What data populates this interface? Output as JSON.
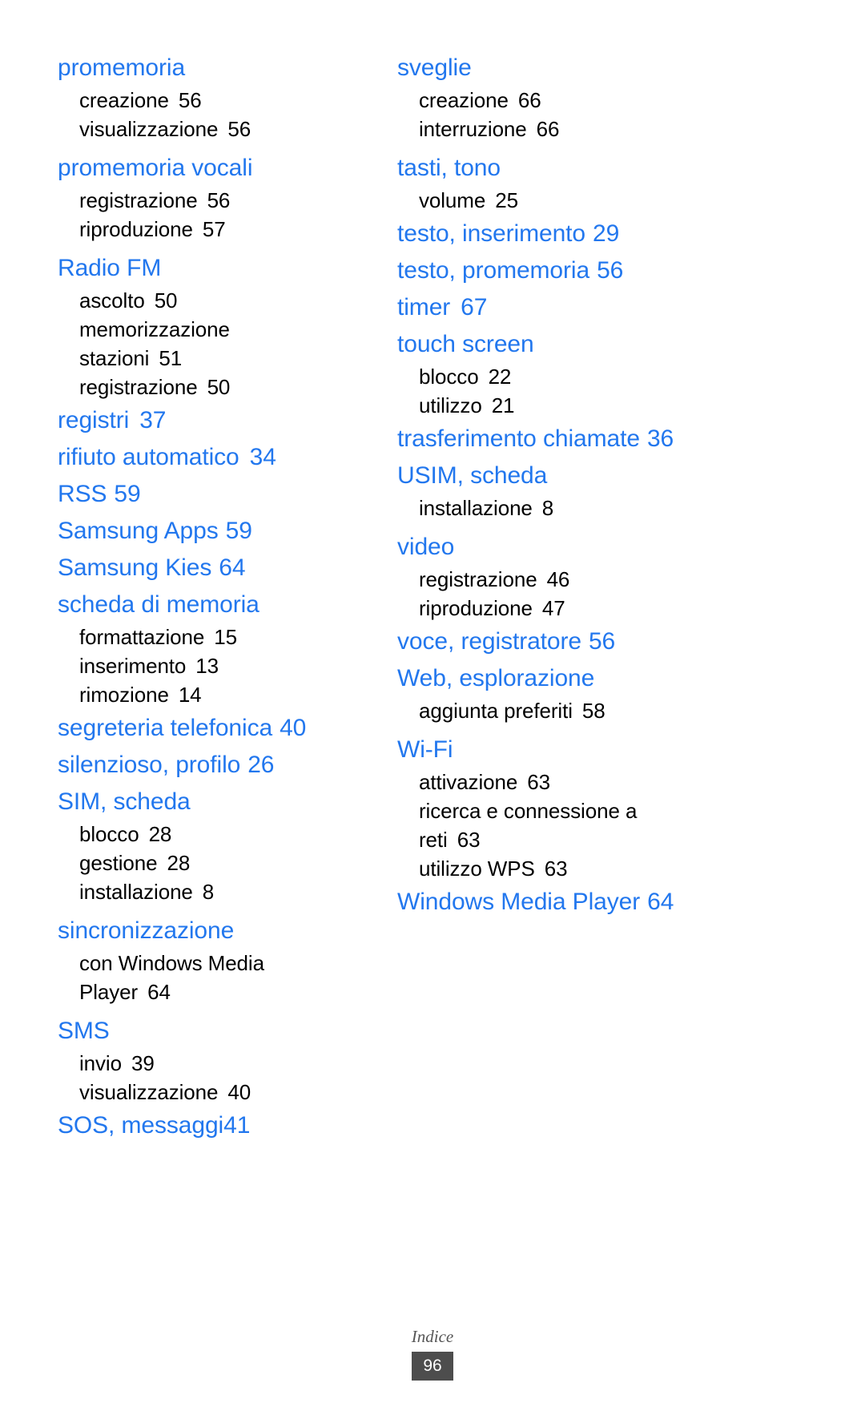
{
  "footer": {
    "section_label": "Indice",
    "page_number": "96"
  },
  "colors": {
    "heading": "#2277ee",
    "body": "#000000",
    "page_badge_bg": "#4d4d4d",
    "page_badge_text": "#ffffff",
    "background": "#ffffff"
  },
  "columns": [
    {
      "entries": [
        {
          "term": "promemoria",
          "page": "",
          "subs": [
            {
              "term": "creazione",
              "page": "56"
            },
            {
              "term": "visualizzazione",
              "page": "56"
            }
          ]
        },
        {
          "term": "promemoria vocali",
          "page": "",
          "subs": [
            {
              "term": "registrazione",
              "page": "56"
            },
            {
              "term": "riproduzione",
              "page": "57"
            }
          ]
        },
        {
          "term": "Radio FM",
          "page": "",
          "subs": [
            {
              "term": "ascolto",
              "page": "50"
            },
            {
              "term": "memorizzazione stazioni",
              "page": "51"
            },
            {
              "term": "registrazione",
              "page": "50"
            }
          ]
        },
        {
          "term": "registri",
          "page": "37",
          "subs": []
        },
        {
          "term": "rifiuto automatico",
          "page": "34",
          "subs": []
        },
        {
          "term": "RSS",
          "page": "59",
          "subs": []
        },
        {
          "term": "Samsung Apps",
          "page": "59",
          "subs": []
        },
        {
          "term": "Samsung Kies",
          "page": "64",
          "subs": []
        },
        {
          "term": "scheda di memoria",
          "page": "",
          "subs": [
            {
              "term": "formattazione",
              "page": "15"
            },
            {
              "term": "inserimento",
              "page": "13"
            },
            {
              "term": "rimozione",
              "page": "14"
            }
          ]
        },
        {
          "term": "segreteria telefonica",
          "page": "40",
          "subs": []
        },
        {
          "term": "silenzioso, profilo",
          "page": "26",
          "subs": []
        },
        {
          "term": "SIM, scheda",
          "page": "",
          "subs": [
            {
              "term": "blocco",
              "page": "28"
            },
            {
              "term": "gestione",
              "page": "28"
            },
            {
              "term": "installazione",
              "page": "8"
            }
          ]
        },
        {
          "term": "sincronizzazione",
          "page": "",
          "subs": [
            {
              "term": "con Windows Media Player",
              "page": "64"
            }
          ]
        },
        {
          "term": "SMS",
          "page": "",
          "subs": [
            {
              "term": "invio",
              "page": "39"
            },
            {
              "term": "visualizzazione",
              "page": "40"
            }
          ]
        },
        {
          "term": "SOS, messaggi",
          "page": "41",
          "subs": []
        }
      ]
    },
    {
      "entries": [
        {
          "term": "sveglie",
          "page": "",
          "subs": [
            {
              "term": "creazione",
              "page": "66"
            },
            {
              "term": "interruzione",
              "page": "66"
            }
          ]
        },
        {
          "term": "tasti, tono",
          "page": "",
          "subs": [
            {
              "term": "volume",
              "page": "25"
            }
          ]
        },
        {
          "term": "testo, inserimento",
          "page": "29",
          "subs": []
        },
        {
          "term": "testo, promemoria",
          "page": "56",
          "subs": []
        },
        {
          "term": "timer",
          "page": "67",
          "subs": []
        },
        {
          "term": "touch screen",
          "page": "",
          "subs": [
            {
              "term": "blocco",
              "page": "22"
            },
            {
              "term": "utilizzo",
              "page": "21"
            }
          ]
        },
        {
          "term": "trasferimento chiamate",
          "page": "36",
          "subs": []
        },
        {
          "term": "USIM, scheda",
          "page": "",
          "subs": [
            {
              "term": "installazione",
              "page": "8"
            }
          ]
        },
        {
          "term": "video",
          "page": "",
          "subs": [
            {
              "term": "registrazione",
              "page": "46"
            },
            {
              "term": "riproduzione",
              "page": "47"
            }
          ]
        },
        {
          "term": "voce, registratore",
          "page": "56",
          "subs": []
        },
        {
          "term": "Web, esplorazione",
          "page": "",
          "subs": [
            {
              "term": "aggiunta preferiti",
              "page": "58"
            }
          ]
        },
        {
          "term": "Wi-Fi",
          "page": "",
          "subs": [
            {
              "term": "attivazione",
              "page": "63"
            },
            {
              "term": "ricerca e connessione a reti",
              "page": "63"
            },
            {
              "term": "utilizzo WPS",
              "page": "63"
            }
          ]
        },
        {
          "term": "Windows Media Player",
          "page": "64",
          "subs": []
        }
      ]
    }
  ]
}
